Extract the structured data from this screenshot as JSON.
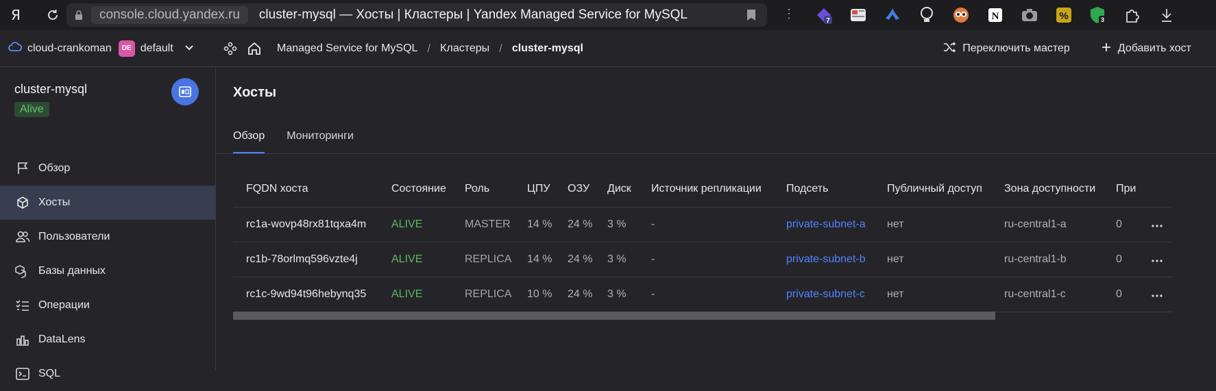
{
  "browser": {
    "address_domain": "console.cloud.yandex.ru",
    "tab_title": "cluster-mysql — Хосты | Кластеры | Yandex Managed Service for MySQL",
    "extensions": [
      {
        "name": "ext-7-icon",
        "badge": "7",
        "color": "#6b4fd8"
      },
      {
        "name": "ext-rss-icon",
        "color": "#d9534f"
      },
      {
        "name": "ext-blue-logo-icon",
        "color": "#3d7de0"
      },
      {
        "name": "ext-bulb-icon",
        "color": "#cfcfd3"
      },
      {
        "name": "ext-glasses-icon",
        "color": "#e07a3d"
      },
      {
        "name": "ext-notion-icon",
        "color": "#ffffff"
      },
      {
        "name": "ext-camera-icon",
        "color": "#9a9aa0"
      },
      {
        "name": "ext-percent-icon",
        "color": "#c9a516"
      },
      {
        "name": "ext-shield-3-icon",
        "badge": "3",
        "color": "#2fa84f"
      },
      {
        "name": "ext-puzzle-icon",
        "color": "#cfcfd3"
      },
      {
        "name": "download-icon",
        "color": "#cfcfd3"
      }
    ]
  },
  "header": {
    "cloud": "cloud-crankoman",
    "folder_badge": "DE",
    "folder": "default",
    "breadcrumbs": [
      "Managed Service for MySQL",
      "Кластеры",
      "cluster-mysql"
    ],
    "actions": {
      "switch_master": "Переключить мастер",
      "add_host": "Добавить хост"
    }
  },
  "sidebar": {
    "cluster_name": "cluster-mysql",
    "status": "Alive",
    "items": [
      {
        "label": "Обзор",
        "icon": "flag-icon"
      },
      {
        "label": "Хосты",
        "icon": "cube-icon",
        "active": true
      },
      {
        "label": "Пользователи",
        "icon": "users-icon"
      },
      {
        "label": "Базы данных",
        "icon": "databases-icon"
      },
      {
        "label": "Операции",
        "icon": "operations-icon"
      },
      {
        "label": "DataLens",
        "icon": "datalens-icon"
      },
      {
        "label": "SQL",
        "icon": "sql-icon"
      }
    ]
  },
  "main": {
    "title": "Хосты",
    "tabs": [
      "Обзор",
      "Мониторинги"
    ],
    "table": {
      "headers": [
        "FQDN хоста",
        "Состояние",
        "Роль",
        "ЦПУ",
        "ОЗУ",
        "Диск",
        "Источник репликации",
        "Подсеть",
        "Публичный доступ",
        "Зона доступности",
        "При"
      ],
      "rows": [
        [
          "rc1a-wovp48rx81tqxa4m",
          "ALIVE",
          "MASTER",
          "14 %",
          "24 %",
          "3 %",
          "-",
          "private-subnet-a",
          "нет",
          "ru-central1-a",
          "0"
        ],
        [
          "rc1b-78orlmq596vzte4j",
          "ALIVE",
          "REPLICA",
          "14 %",
          "24 %",
          "3 %",
          "-",
          "private-subnet-b",
          "нет",
          "ru-central1-b",
          "0"
        ],
        [
          "rc1c-9wd94t96hebynq35",
          "ALIVE",
          "REPLICA",
          "10 %",
          "24 %",
          "3 %",
          "-",
          "private-subnet-c",
          "нет",
          "ru-central1-c",
          "0"
        ]
      ]
    }
  }
}
